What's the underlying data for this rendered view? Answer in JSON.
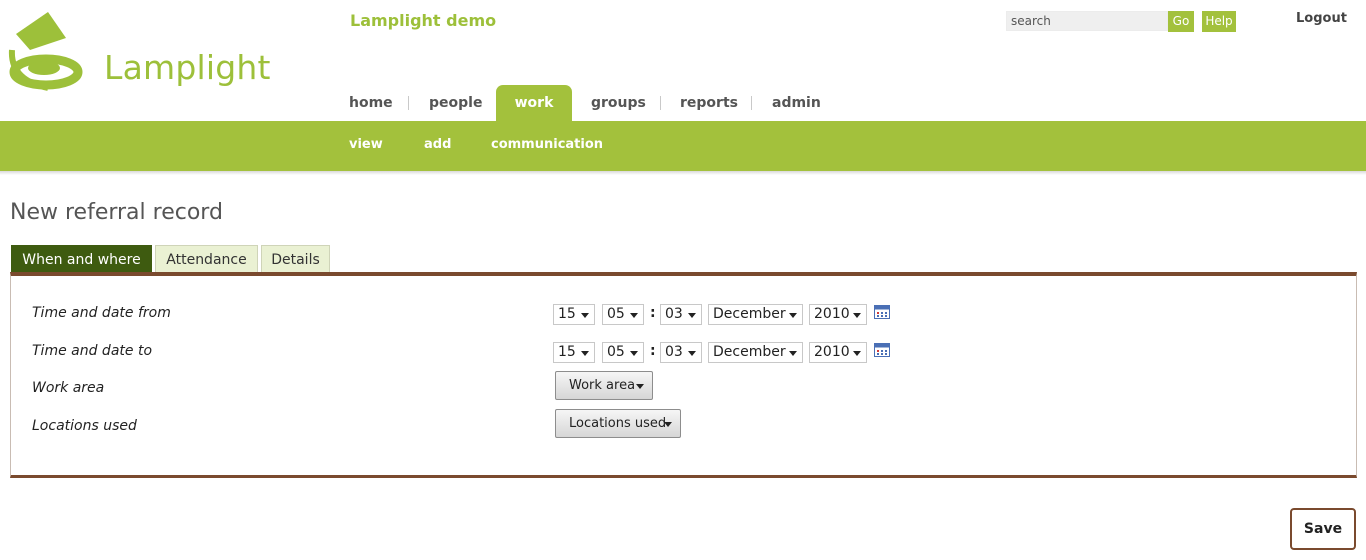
{
  "brand": {
    "logo_text": "Lamplight",
    "app_title": "Lamplight demo",
    "accent": "#a3c13c"
  },
  "header": {
    "search_placeholder": "search",
    "go_label": "Go",
    "help_label": "Help",
    "logout_label": "Logout"
  },
  "nav": {
    "items": [
      {
        "label": "home"
      },
      {
        "label": "people"
      },
      {
        "label": "work",
        "active": true
      },
      {
        "label": "groups"
      },
      {
        "label": "reports"
      },
      {
        "label": "admin"
      }
    ]
  },
  "subnav": {
    "items": [
      {
        "label": "view"
      },
      {
        "label": "add"
      },
      {
        "label": "communication"
      }
    ]
  },
  "page": {
    "title": "New referral record"
  },
  "tabs": [
    {
      "label": "When and where",
      "active": true
    },
    {
      "label": "Attendance"
    },
    {
      "label": "Details"
    }
  ],
  "form": {
    "from": {
      "label": "Time and date from",
      "hour": "15",
      "minute": "05",
      "day": "03",
      "month": "December",
      "year": "2010"
    },
    "to": {
      "label": "Time and date to",
      "hour": "15",
      "minute": "05",
      "day": "03",
      "month": "December",
      "year": "2010"
    },
    "time_separator": ":",
    "work_area": {
      "label": "Work area",
      "button": "Work area"
    },
    "locations": {
      "label": "Locations used",
      "button": "Locations used"
    }
  },
  "actions": {
    "save_label": "Save"
  }
}
